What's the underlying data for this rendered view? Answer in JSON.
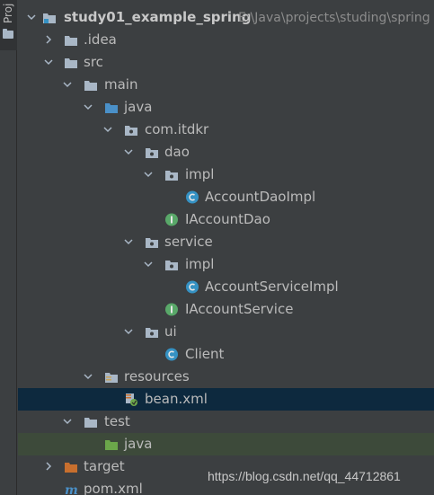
{
  "sidebar": {
    "tab_label": "Proj"
  },
  "project": {
    "name": "study01_example_spring",
    "path": "E:\\Java\\projects\\studing\\spring"
  },
  "tree": {
    "idea": ".idea",
    "src": "src",
    "main": "main",
    "java_main": "java",
    "package": "com.itdkr",
    "dao": "dao",
    "dao_impl": "impl",
    "account_dao_impl": "AccountDaoImpl",
    "iaccount_dao": "IAccountDao",
    "service": "service",
    "service_impl": "impl",
    "account_service_impl": "AccountServiceImpl",
    "iaccount_service": "IAccountService",
    "ui": "ui",
    "client": "Client",
    "resources": "resources",
    "bean_xml": "bean.xml",
    "test": "test",
    "java_test": "java",
    "target": "target",
    "pom": "pom.xml"
  },
  "watermark": "https://blog.csdn.net/qq_44712861",
  "colors": {
    "background": "#3c3f41",
    "selection": "#0d293e",
    "folder": "#a9b7c6",
    "source_folder": "#4a90c8",
    "test_folder": "#6ba64a",
    "excluded_folder": "#c86f2e",
    "class_icon": "#3592c4",
    "interface_icon": "#59a869"
  }
}
